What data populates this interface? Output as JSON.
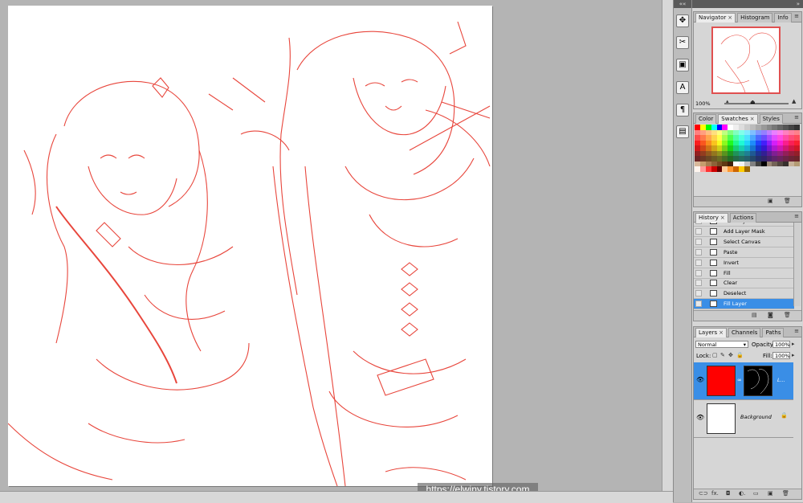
{
  "canvas": {
    "watermark": "https://elwiny.tistory.com",
    "line_color": "#e8463c"
  },
  "toolstrip": {
    "top_label": "««",
    "tools": [
      {
        "name": "navigator-tool-icon",
        "glyph": "✥"
      },
      {
        "name": "brush-tool-icon",
        "glyph": "✂"
      },
      {
        "name": "layer-comps-icon",
        "glyph": "▣"
      },
      {
        "name": "character-panel-icon",
        "glyph": "A"
      },
      {
        "name": "paragraph-panel-icon",
        "glyph": "¶"
      },
      {
        "name": "notes-panel-icon",
        "glyph": "▤"
      }
    ]
  },
  "panels": {
    "top_label": "»"
  },
  "navigator": {
    "tabs": [
      {
        "label": "Navigator",
        "close": "×"
      },
      {
        "label": "Histogram"
      },
      {
        "label": "Info"
      }
    ],
    "zoom": "100%"
  },
  "swatches": {
    "tabs": [
      {
        "label": "Color"
      },
      {
        "label": "Swatches",
        "close": "×"
      },
      {
        "label": "Styles"
      }
    ]
  },
  "history": {
    "tabs": [
      {
        "label": "History",
        "close": "×"
      },
      {
        "label": "Actions"
      }
    ],
    "items": [
      "New Layer",
      "Add Layer Mask",
      "Select Canvas",
      "Paste",
      "Invert",
      "Fill",
      "Clear",
      "Deselect",
      "Fill Layer"
    ],
    "selected_index": 8
  },
  "layers": {
    "tabs": [
      {
        "label": "Layers",
        "close": "×"
      },
      {
        "label": "Channels"
      },
      {
        "label": "Paths"
      }
    ],
    "blend_mode": "Normal",
    "opacity_label": "Opacity:",
    "opacity": "100%",
    "lock_label": "Lock:",
    "fill_label": "Fill:",
    "fill": "100%",
    "rows": [
      {
        "name": "L...",
        "fill_color": "#ff0000",
        "selected": true
      },
      {
        "name": "Background",
        "fill_color": "#ffffff",
        "selected": false
      }
    ],
    "footer_icons": "⊂⊃  fx.  ◘  ◐.  ▭  ▣  🗑"
  },
  "colors": {
    "accent": "#3a8ee6",
    "line_red": "#e8463c",
    "panel_bg": "#d6d6d6",
    "workspace": "#b4b4b4"
  }
}
